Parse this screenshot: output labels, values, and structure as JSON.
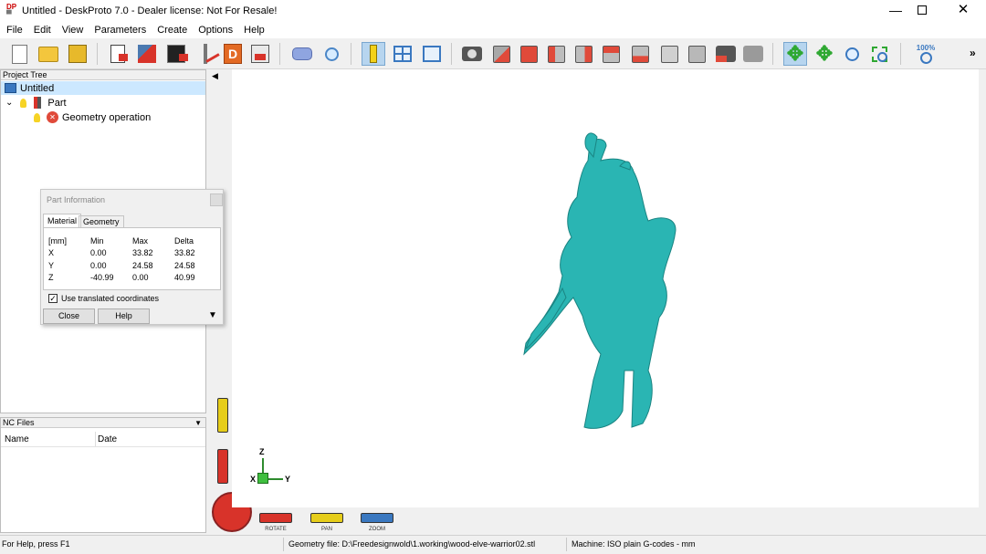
{
  "window": {
    "title": "Untitled - DeskProto 7.0 - Dealer license: Not For Resale!",
    "app_icon": "DeskProto-logo",
    "controls": [
      "minimize",
      "maximize",
      "close"
    ]
  },
  "menu": [
    "File",
    "Edit",
    "View",
    "Parameters",
    "Create",
    "Options",
    "Help"
  ],
  "toolbar": {
    "zoom_label": "100%",
    "overflow": "»",
    "icons": [
      "new-icon",
      "open-folder-icon",
      "save-icon",
      "import-part-icon",
      "import-vector-icon",
      "import-bitmap-icon",
      "toolpath-icon",
      "drawing-icon",
      "export-icon",
      "part-icon",
      "inspect-icon",
      "info-icon",
      "split-view-icon",
      "preview-icon",
      "camera-icon",
      "view-front-icon",
      "view-back-icon",
      "view-left-icon",
      "view-right-icon",
      "view-top-icon",
      "view-bottom-icon",
      "view-iso1-icon",
      "view-iso2-icon",
      "render-icon",
      "render-alt-icon",
      "rotate-icon",
      "pan-icon",
      "zoom-in-icon",
      "zoom-window-icon",
      "zoom-100-icon"
    ]
  },
  "project_tree": {
    "header": "Project Tree",
    "root": "Untitled",
    "part": "Part",
    "operation": "Geometry operation"
  },
  "nc_files": {
    "header": "NC Files",
    "columns": [
      "Name",
      "Date"
    ]
  },
  "part_info": {
    "title": "Part Information",
    "tabs": [
      "Material",
      "Geometry"
    ],
    "headers": [
      "[mm]",
      "Min",
      "Max",
      "Delta"
    ],
    "rows": [
      [
        "X",
        "0.00",
        "33.82",
        "33.82"
      ],
      [
        "Y",
        "0.00",
        "24.58",
        "24.58"
      ],
      [
        "Z",
        "-40.99",
        "0.00",
        "40.99"
      ]
    ],
    "checkbox_label": "Use translated coordinates",
    "checkbox_checked": true,
    "close_label": "Close",
    "help_label": "Help"
  },
  "viewport": {
    "model_color": "#2ab5b3",
    "axes": {
      "z": "Z",
      "y": "Y",
      "x": "X"
    },
    "controls": {
      "rotate": "ROTATE",
      "pan": "PAN",
      "zoom": "ZOOM"
    }
  },
  "status": {
    "help": "For Help, press F1",
    "geometry": "Geometry file: D:\\Freedesignwold\\1.working\\wood-elve-warrior02.stl",
    "machine": "Machine: ISO plain G-codes - mm"
  }
}
